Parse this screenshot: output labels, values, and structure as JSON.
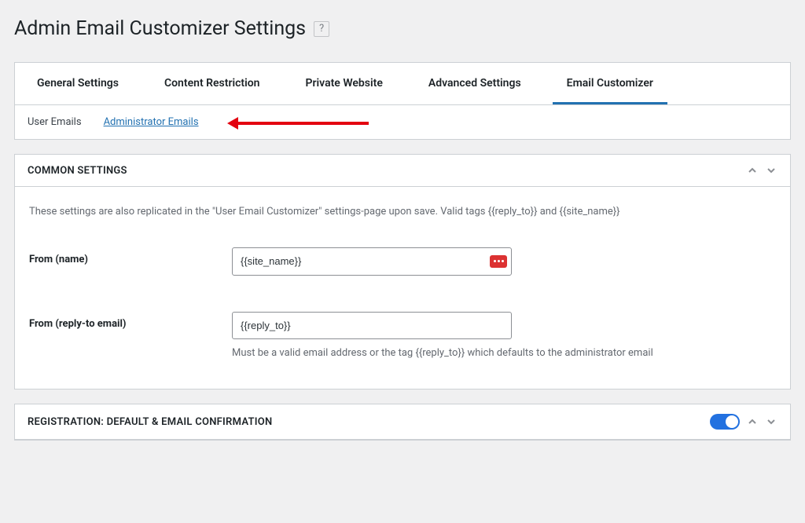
{
  "header": {
    "title": "Admin Email Customizer Settings"
  },
  "tabs": [
    {
      "label": "General Settings",
      "active": false
    },
    {
      "label": "Content Restriction",
      "active": false
    },
    {
      "label": "Private Website",
      "active": false
    },
    {
      "label": "Advanced Settings",
      "active": false
    },
    {
      "label": "Email Customizer",
      "active": true
    }
  ],
  "subtabs": {
    "user_emails": "User Emails",
    "admin_emails": "Administrator Emails"
  },
  "common": {
    "heading": "COMMON SETTINGS",
    "description": "These settings are also replicated in the \"User Email Customizer\" settings-page upon save. Valid tags {{reply_to}} and {{site_name}}",
    "from_name_label": "From (name)",
    "from_name_value": "{{site_name}}",
    "from_email_label": "From (reply-to email)",
    "from_email_value": "{{reply_to}}",
    "from_email_help": "Must be a valid email address or the tag {{reply_to}} which defaults to the administrator email"
  },
  "registration": {
    "heading": "REGISTRATION: DEFAULT & EMAIL CONFIRMATION",
    "enabled": true
  }
}
